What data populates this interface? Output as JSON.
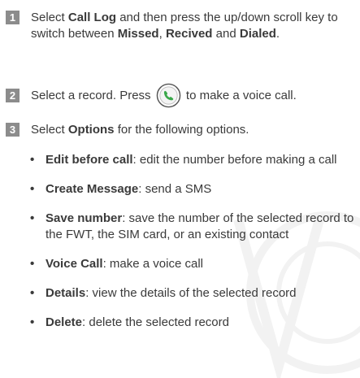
{
  "steps": [
    {
      "number": "1",
      "parts": [
        "Select ",
        "Call Log",
        " and then press the up/down scroll key to switch between ",
        "Missed",
        ", ",
        "Recived",
        " and ",
        "Dialed",
        "."
      ]
    },
    {
      "number": "2",
      "before_icon": "Select a record. Press ",
      "icon": "green-call-key-icon",
      "after_icon": " to make a voice call."
    },
    {
      "number": "3",
      "parts": [
        "Select ",
        "Options",
        " for the following options."
      ]
    }
  ],
  "options": [
    {
      "term": "Edit before call",
      "desc": ": edit the number before making a call"
    },
    {
      "term": "Create Message",
      "desc": ": send a SMS"
    },
    {
      "term": "Save number",
      "desc": ": save the number of the selected record to the FWT, the SIM card, or an existing contact"
    },
    {
      "term": "Voice Call",
      "desc": ": make a voice call"
    },
    {
      "term": "Details",
      "desc": ": view the details of the selected record"
    },
    {
      "term": "Delete",
      "desc": ": delete the selected record"
    }
  ],
  "bullet_glyph": "•",
  "colors": {
    "text": "#3a3a3a",
    "step_badge": "#8c8c8c",
    "call_icon": "#3aa84a"
  }
}
